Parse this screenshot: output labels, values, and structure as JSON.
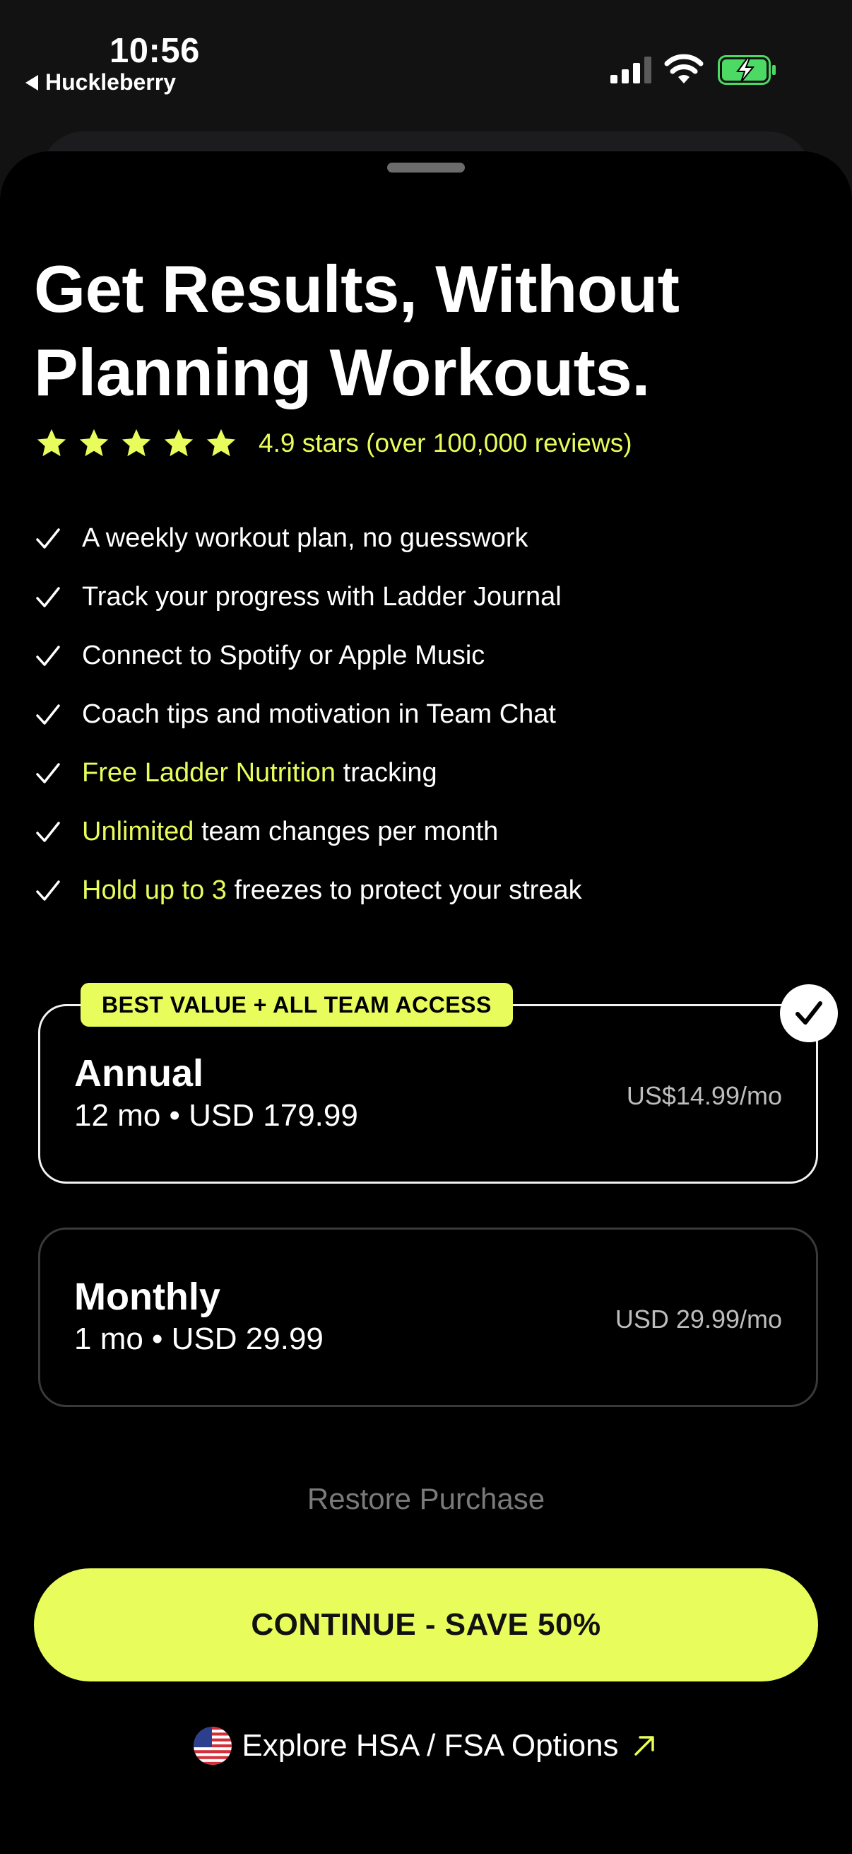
{
  "status_bar": {
    "time": "10:56",
    "back_app": "Huckleberry",
    "signal_icon": "cellular-signal-icon",
    "wifi_icon": "wifi-icon",
    "battery_icon": "battery-charging-icon"
  },
  "paywall": {
    "headline": "Get Results, Without Planning Workouts.",
    "rating_text": "4.9 stars (over 100,000 reviews)",
    "rating_stars": 5,
    "features": [
      {
        "highlight": "",
        "text": "A weekly workout plan, no guesswork"
      },
      {
        "highlight": "",
        "text": "Track your progress with Ladder Journal"
      },
      {
        "highlight": "",
        "text": "Connect to Spotify or Apple Music"
      },
      {
        "highlight": "",
        "text": "Coach tips and motivation in Team Chat"
      },
      {
        "highlight": "Free Ladder Nutrition",
        "text": " tracking"
      },
      {
        "highlight": "Unlimited",
        "text": " team changes per month"
      },
      {
        "highlight": "Hold up to 3",
        "text": " freezes to protect your streak"
      }
    ],
    "plans": {
      "annual": {
        "badge": "BEST VALUE + ALL TEAM ACCESS",
        "name": "Annual",
        "sub": "12 mo • USD 179.99",
        "price": "US$14.99/mo",
        "selected": true
      },
      "monthly": {
        "name": "Monthly",
        "sub": "1 mo • USD 29.99",
        "price": "USD 29.99/mo",
        "selected": false
      }
    },
    "restore_label": "Restore Purchase",
    "cta_label": "CONTINUE - SAVE 50%",
    "hsa_label": "Explore HSA / FSA Options"
  },
  "colors": {
    "accent": "#e8fc5b",
    "background": "#000000",
    "muted_text": "#7a7a7a"
  }
}
